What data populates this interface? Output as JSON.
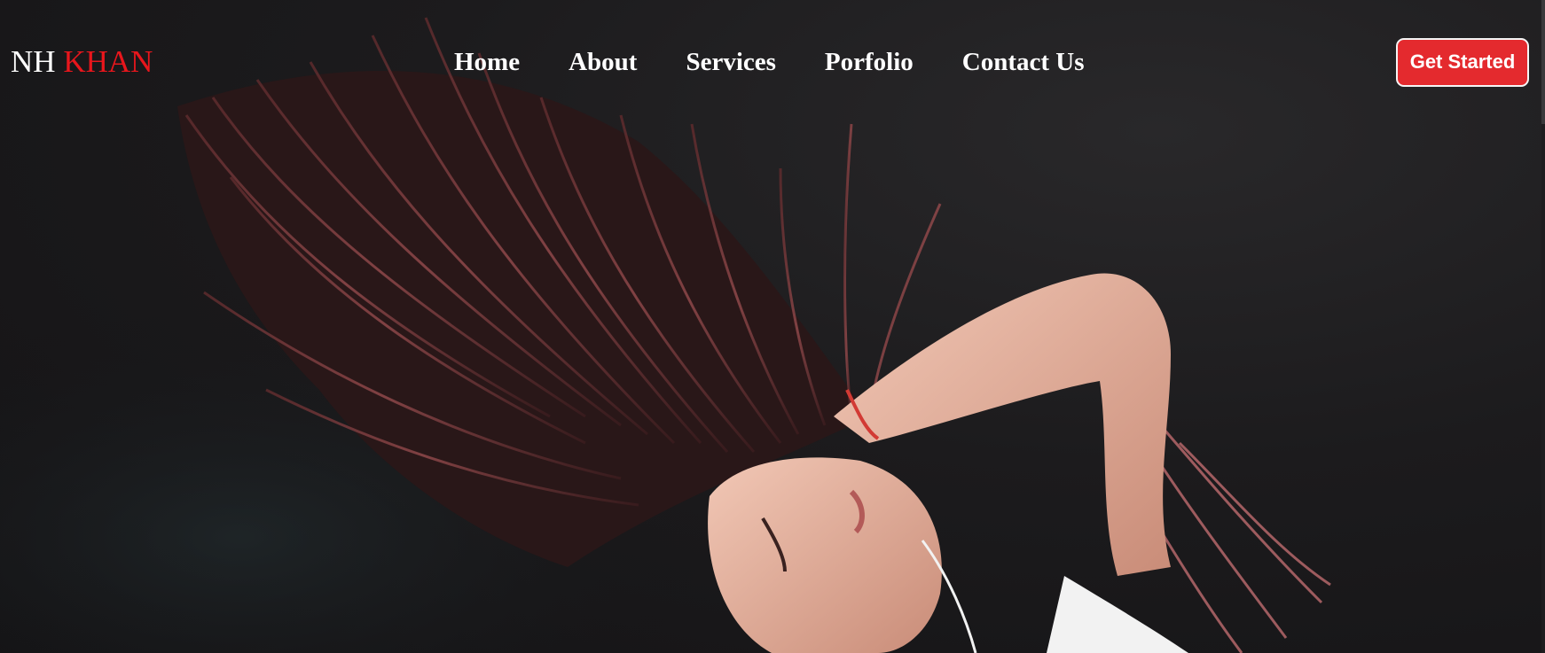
{
  "brand": {
    "first": "NH",
    "second": "KHAN",
    "accent_color": "#e8161c"
  },
  "nav": {
    "items": [
      {
        "label": "Home"
      },
      {
        "label": "About"
      },
      {
        "label": "Services"
      },
      {
        "label": "Porfolio"
      },
      {
        "label": "Contact Us"
      }
    ]
  },
  "cta": {
    "label": "Get Started",
    "color": "#e42a2e"
  },
  "hero": {
    "image": "hero-photo"
  }
}
